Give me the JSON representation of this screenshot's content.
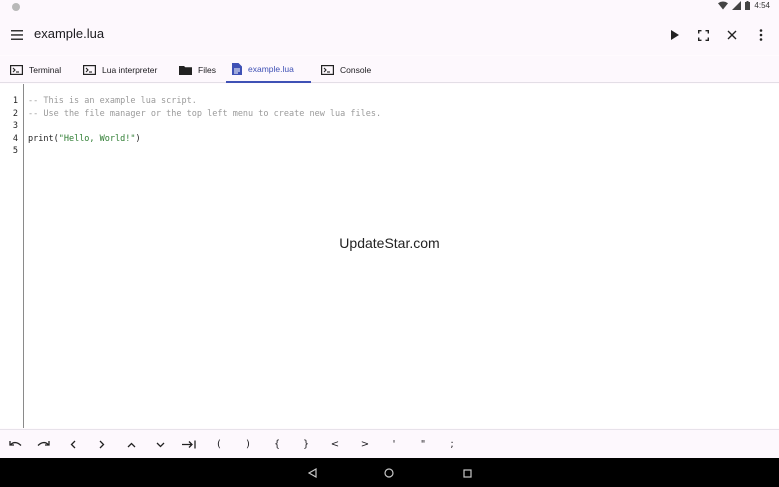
{
  "status_bar": {
    "time": "4:54"
  },
  "app_bar": {
    "title": "example.lua",
    "actions": [
      "play-icon",
      "fullscreen-icon",
      "close-icon",
      "more-vert-icon"
    ]
  },
  "tabs": [
    {
      "label": "Terminal",
      "icon": "terminal-icon",
      "active": false
    },
    {
      "label": "Lua interpreter",
      "icon": "terminal-icon",
      "active": false
    },
    {
      "label": "Files",
      "icon": "folder-icon",
      "active": false
    },
    {
      "label": "example.lua",
      "icon": "file-icon",
      "active": true
    },
    {
      "label": "Console",
      "icon": "terminal-icon",
      "active": false
    }
  ],
  "editor": {
    "line_numbers": [
      "1",
      "2",
      "3",
      "4",
      "5"
    ],
    "lines": [
      {
        "text": "-- This is an example lua script.",
        "kind": "comment"
      },
      {
        "text": "-- Use the file manager or the top left menu to create new lua files.",
        "kind": "comment"
      },
      {
        "text": "",
        "kind": "plain"
      },
      {
        "pre": "print(",
        "string": "\"Hello, World!\"",
        "post": ")",
        "kind": "call"
      },
      {
        "text": "",
        "kind": "plain"
      }
    ]
  },
  "watermark": "UpdateStar.com",
  "symbol_bar": {
    "undo": "undo-icon",
    "redo": "redo-icon",
    "keys": [
      "<",
      ">",
      "^",
      "v",
      "tab-icon"
    ],
    "symbols": [
      "(",
      ")",
      "{",
      "}",
      "<",
      ">",
      "'",
      "\"",
      ";"
    ]
  },
  "colors": {
    "accent": "#3f51b5",
    "comment": "#9a9a9a",
    "string": "#2e7d32"
  }
}
